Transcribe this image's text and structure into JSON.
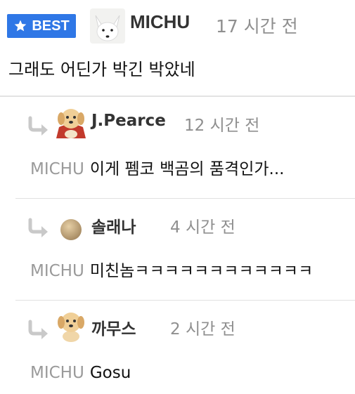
{
  "best_badge": {
    "label": "BEST"
  },
  "top_comment": {
    "author": "MICHU",
    "time": "17 시간 전",
    "text": "그래도 어딘가 박긴 박았네"
  },
  "replies": [
    {
      "author": "J.Pearce",
      "time": "12 시간 전",
      "mention": "MICHU",
      "text": "이게 펨코 백곰의 품격인가..."
    },
    {
      "author": "솔래나",
      "time": "4 시간 전",
      "mention": "MICHU",
      "text": "미친놈ㅋㅋㅋㅋㅋㅋㅋㅋㅋㅋㅋㅋ"
    },
    {
      "author": "까무스",
      "time": "2 시간 전",
      "mention": "MICHU",
      "text": "Gosu"
    }
  ]
}
